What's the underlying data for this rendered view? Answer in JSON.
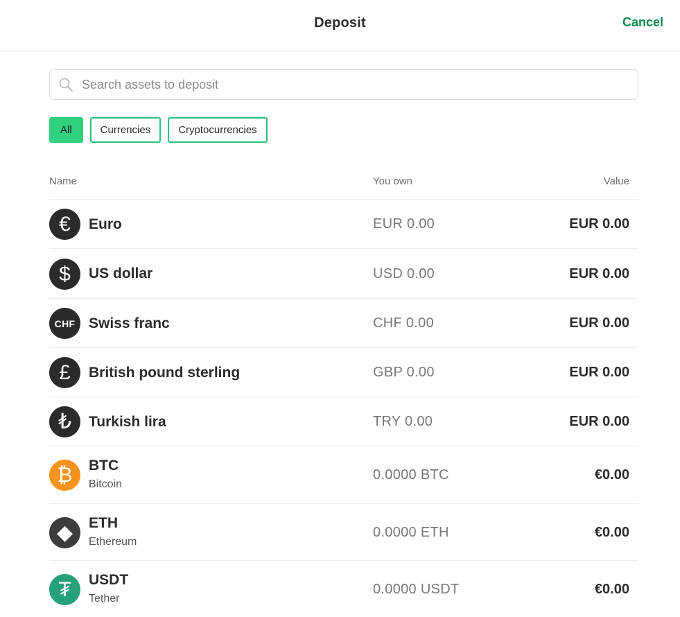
{
  "header": {
    "title": "Deposit",
    "cancel_label": "Cancel"
  },
  "search": {
    "placeholder": "Search assets to deposit",
    "value": ""
  },
  "filters": [
    {
      "label": "All",
      "active": true
    },
    {
      "label": "Currencies",
      "active": false
    },
    {
      "label": "Cryptocurrencies",
      "active": false
    }
  ],
  "columns": {
    "name": "Name",
    "own": "You own",
    "value": "Value"
  },
  "assets": [
    {
      "name": "Euro",
      "own": "EUR 0.00",
      "value": "EUR 0.00",
      "icon": "euro-icon",
      "glyph": "€",
      "color": "#2b2b2b"
    },
    {
      "name": "US dollar",
      "own": "USD 0.00",
      "value": "EUR 0.00",
      "icon": "dollar-icon",
      "glyph": "$",
      "color": "#2b2b2b"
    },
    {
      "name": "Swiss franc",
      "own": "CHF 0.00",
      "value": "EUR 0.00",
      "icon": "chf-icon",
      "glyph": "CHF",
      "color": "#2b2b2b"
    },
    {
      "name": "British pound sterling",
      "own": "GBP 0.00",
      "value": "EUR 0.00",
      "icon": "pound-icon",
      "glyph": "£",
      "color": "#2b2b2b"
    },
    {
      "name": "Turkish lira",
      "own": "TRY 0.00",
      "value": "EUR 0.00",
      "icon": "lira-icon",
      "glyph": "₺",
      "color": "#2b2b2b"
    },
    {
      "name": "BTC",
      "subtitle": "Bitcoin",
      "own": "0.0000 BTC",
      "value": "€0.00",
      "icon": "bitcoin-icon",
      "glyph": "₿",
      "color": "#f7931a"
    },
    {
      "name": "ETH",
      "subtitle": "Ethereum",
      "own": "0.0000 ETH",
      "value": "€0.00",
      "icon": "ethereum-icon",
      "glyph": "◆",
      "color": "#3c3c3d"
    },
    {
      "name": "USDT",
      "subtitle": "Tether",
      "own": "0.0000 USDT",
      "value": "€0.00",
      "icon": "tether-icon",
      "glyph": "₮",
      "color": "#26a17b"
    }
  ]
}
